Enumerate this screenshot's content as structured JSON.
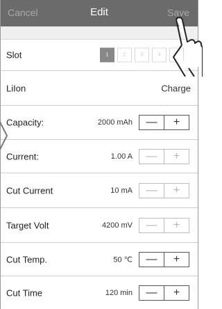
{
  "header": {
    "cancel_label": "Cancel",
    "title": "Edit",
    "save_label": "Save"
  },
  "slot_row": {
    "label": "Slot",
    "slots": [
      "1",
      "2",
      "3",
      "4",
      "All"
    ],
    "selected": "1"
  },
  "battery_row": {
    "label": "LiIon",
    "value": "Charge"
  },
  "settings": [
    {
      "label": "Capacity:",
      "value": "2000 mAh"
    },
    {
      "label": "Current:",
      "value": "1.00 A"
    },
    {
      "label": "Cut Current",
      "value": "10 mA"
    },
    {
      "label": "Target Volt",
      "value": "4200 mV"
    },
    {
      "label": "Cut Temp.",
      "value": "50 ℃"
    },
    {
      "label": "Cut Time",
      "value": "120 min"
    }
  ],
  "stepper": {
    "minus_symbol": "—",
    "plus_symbol": "+"
  },
  "icons": {
    "left_arrow": "chevron-left-icon",
    "pointer": "hand-pointer-icon"
  },
  "colors": {
    "navbar": "#6b6b6b",
    "selected_slot": "#888888"
  }
}
